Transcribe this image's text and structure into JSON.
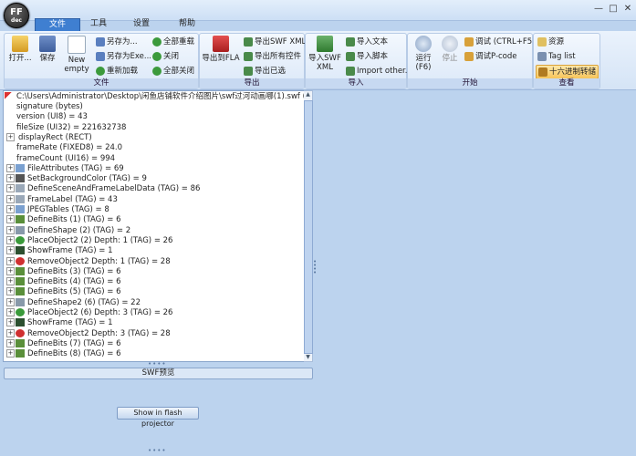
{
  "app": {
    "logo_line1": "FF",
    "logo_line2": "dec"
  },
  "menu": {
    "tabs": [
      "文件",
      "工具",
      "设置",
      "帮助"
    ]
  },
  "window": {
    "minimize": "—",
    "maximize": "□",
    "close": "✕"
  },
  "ribbon": {
    "file_group": {
      "label": "文件",
      "open": "打开...",
      "save": "保存",
      "new_empty_line1": "New",
      "new_empty_line2": "empty",
      "save_as": "另存为...",
      "save_as_exe": "另存为Exe...",
      "reload": "重新加载",
      "reload_all": "全部重载",
      "close": "关闭",
      "close_all": "全部关闭"
    },
    "export_group": {
      "label": "导出",
      "export_fla": "导出到FLA",
      "export_swf_xml": "导出SWF XML",
      "export_all": "导出所有控件",
      "export_selected": "导出已选"
    },
    "import_group": {
      "label": "导入",
      "import_swf_xml_line1": "导入SWF",
      "import_swf_xml_line2": "XML",
      "import_text": "导入文本",
      "import_script": "导入脚本",
      "import_other": "Import other..."
    },
    "start_group": {
      "label": "开始",
      "run_line1": "运行",
      "run_line2": "(F6)",
      "stop": "停止",
      "debug": "调试 (CTRL+F5)",
      "debug_pcode": "调试P-code"
    },
    "view_group": {
      "label": "查看",
      "resources": "资源",
      "tag_list": "Tag list",
      "hex_dump": "十六进制转储"
    }
  },
  "tree": {
    "root": "C:\\Users\\Administrator\\Desktop\\闲鱼店铺软件介绍图片\\swf过河动画哪(1).swf ()",
    "items": [
      {
        "text": "signature (bytes)",
        "toggle": "",
        "icon": ""
      },
      {
        "text": "version (UI8) = 43",
        "toggle": "",
        "icon": ""
      },
      {
        "text": "fileSize (UI32) = 221632738",
        "toggle": "",
        "icon": ""
      },
      {
        "text": "displayRect (RECT)",
        "toggle": "+",
        "icon": ""
      },
      {
        "text": "frameRate (FIXED8) = 24.0",
        "toggle": "",
        "icon": ""
      },
      {
        "text": "frameCount (UI16) = 994",
        "toggle": "",
        "icon": ""
      },
      {
        "text": "FileAttributes (TAG) = 69",
        "toggle": "+",
        "icon": "file"
      },
      {
        "text": "SetBackgroundColor (TAG) = 9",
        "toggle": "+",
        "icon": "color"
      },
      {
        "text": "DefineSceneAndFrameLabelData (TAG) = 86",
        "toggle": "+",
        "icon": "label"
      },
      {
        "text": "FrameLabel (TAG) = 43",
        "toggle": "+",
        "icon": "label"
      },
      {
        "text": "JPEGTables (TAG) = 8",
        "toggle": "+",
        "icon": "file"
      },
      {
        "text": "DefineBits (1) (TAG) = 6",
        "toggle": "+",
        "icon": "image"
      },
      {
        "text": "DefineShape (2) (TAG) = 2",
        "toggle": "+",
        "icon": "shape"
      },
      {
        "text": "PlaceObject2 (2) Depth: 1 (TAG) = 26",
        "toggle": "+",
        "icon": "place"
      },
      {
        "text": "ShowFrame (TAG) = 1",
        "toggle": "+",
        "icon": "frame"
      },
      {
        "text": "RemoveObject2 Depth: 1 (TAG) = 28",
        "toggle": "+",
        "icon": "remove"
      },
      {
        "text": "DefineBits (3) (TAG) = 6",
        "toggle": "+",
        "icon": "image"
      },
      {
        "text": "DefineBits (4) (TAG) = 6",
        "toggle": "+",
        "icon": "image"
      },
      {
        "text": "DefineBits (5) (TAG) = 6",
        "toggle": "+",
        "icon": "image"
      },
      {
        "text": "DefineShape2 (6) (TAG) = 22",
        "toggle": "+",
        "icon": "shape"
      },
      {
        "text": "PlaceObject2 (6) Depth: 3 (TAG) = 26",
        "toggle": "+",
        "icon": "place"
      },
      {
        "text": "ShowFrame (TAG) = 1",
        "toggle": "+",
        "icon": "frame"
      },
      {
        "text": "RemoveObject2 Depth: 3 (TAG) = 28",
        "toggle": "+",
        "icon": "remove"
      },
      {
        "text": "DefineBits (7) (TAG) = 6",
        "toggle": "+",
        "icon": "image"
      },
      {
        "text": "DefineBits (8) (TAG) = 6",
        "toggle": "+",
        "icon": "image"
      }
    ]
  },
  "preview": {
    "title": "SWF预览",
    "flash_button": "Show in flash projector"
  },
  "icon_colors": {
    "file": "#7aa0d0",
    "color": "#555555",
    "label": "#9aa8b8",
    "image": "#5a8f3a",
    "shape": "#8899aa",
    "place": "#3a9a3a",
    "frame": "#2c5030",
    "remove": "#d03030"
  }
}
